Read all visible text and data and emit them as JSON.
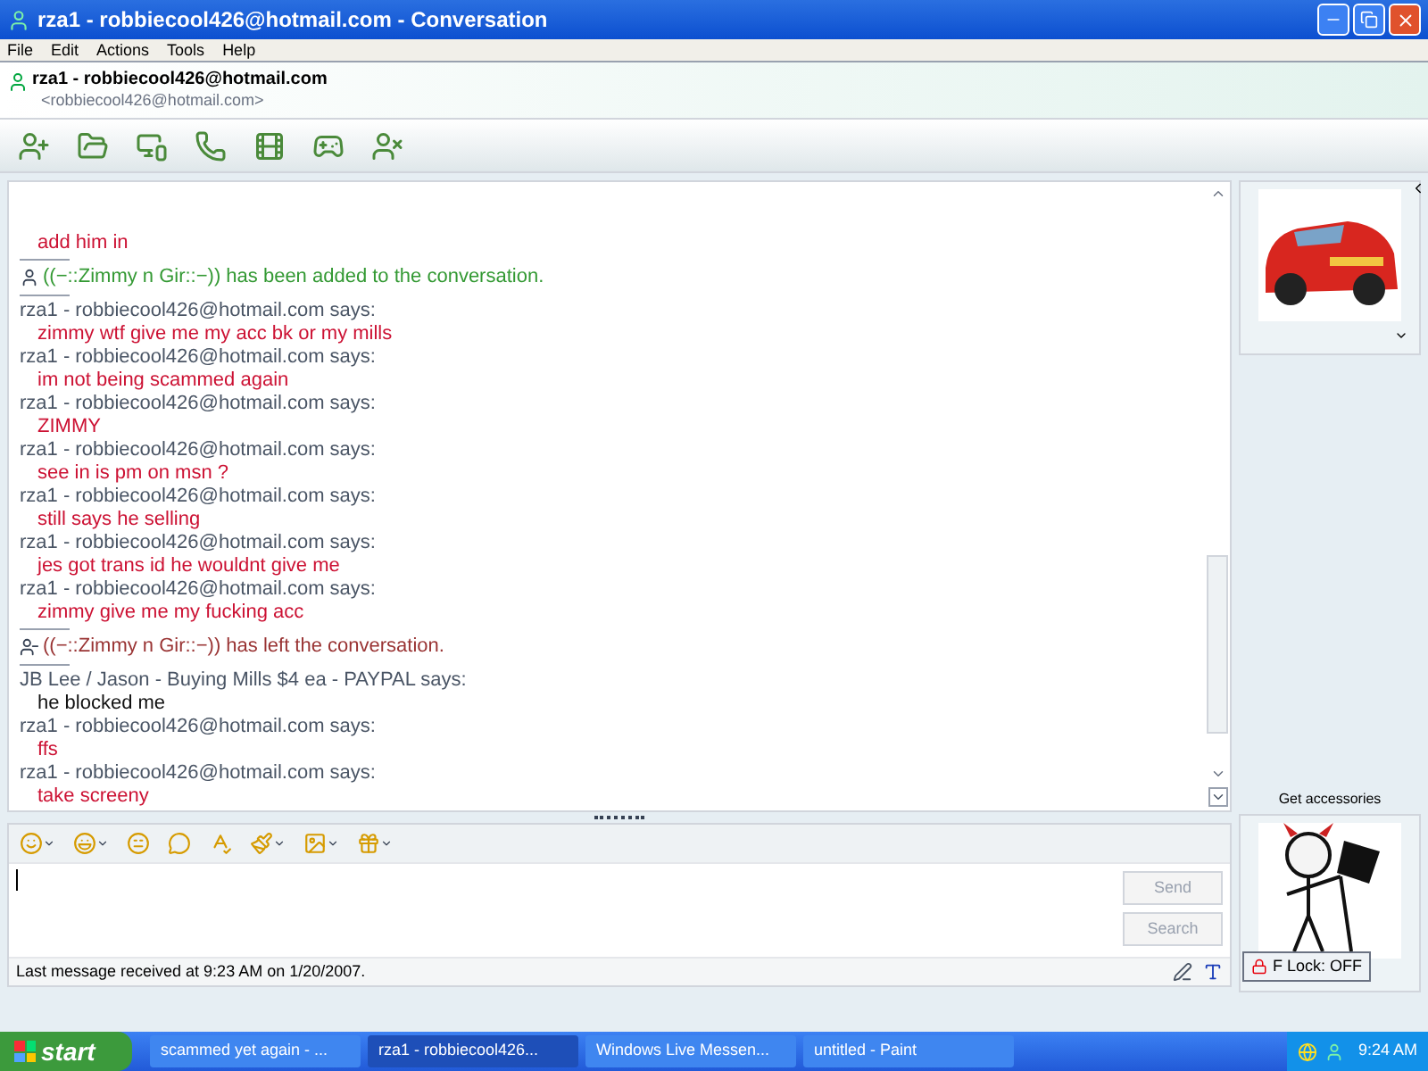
{
  "window": {
    "title": "rza1 - robbiecool426@hotmail.com - Conversation"
  },
  "menu": [
    "File",
    "Edit",
    "Actions",
    "Tools",
    "Help"
  ],
  "contact": {
    "name": "rza1 - robbiecool426@hotmail.com",
    "email": "<robbiecool426@hotmail.com>"
  },
  "messages": [
    {
      "kind": "message",
      "text": "add him in",
      "color": "#cc1133"
    },
    {
      "kind": "joined",
      "text": "((−::Zimmy n Gir::−)) has been added to the conversation.",
      "color": "#339933"
    },
    {
      "kind": "message",
      "sender": "rza1 - robbiecool426@hotmail.com says:",
      "text": "zimmy wtf give me my acc bk or my mills",
      "color": "#cc1133"
    },
    {
      "kind": "message",
      "sender": "rza1 - robbiecool426@hotmail.com says:",
      "text": "im not being scammed again",
      "color": "#cc1133"
    },
    {
      "kind": "message",
      "sender": "rza1 - robbiecool426@hotmail.com says:",
      "text": "ZIMMY",
      "color": "#cc1133"
    },
    {
      "kind": "message",
      "sender": "rza1 - robbiecool426@hotmail.com says:",
      "text": "see in is pm on msn ?",
      "color": "#cc1133"
    },
    {
      "kind": "message",
      "sender": "rza1 - robbiecool426@hotmail.com says:",
      "text": "still says he selling",
      "color": "#cc1133"
    },
    {
      "kind": "message",
      "sender": "rza1 - robbiecool426@hotmail.com says:",
      "text": "jes got trans id he wouldnt give me",
      "color": "#cc1133"
    },
    {
      "kind": "message",
      "sender": "rza1 - robbiecool426@hotmail.com says:",
      "text": "zimmy give me my fucking acc",
      "color": "#cc1133"
    },
    {
      "kind": "left",
      "text": "((−::Zimmy n Gir::−)) has left the conversation.",
      "color": "#993333"
    },
    {
      "kind": "message",
      "sender": "JB Lee / Jason - Buying Mills $4 ea - PAYPAL says:",
      "text": "he blocked me",
      "color": "#111111"
    },
    {
      "kind": "message",
      "sender": "rza1 - robbiecool426@hotmail.com says:",
      "text": "ffs",
      "color": "#cc1133"
    },
    {
      "kind": "message",
      "sender": "rza1 - robbiecool426@hotmail.com says:",
      "text": "take screeny",
      "color": "#cc1133"
    }
  ],
  "input": {
    "send": {
      "label": "Send",
      "disabled": true
    },
    "search": {
      "label": "Search",
      "disabled": true
    }
  },
  "status": "Last message received at 9:23 AM on 1/20/2007.",
  "sidebar": {
    "accessories": "Get accessories",
    "tooltip": "F Lock: OFF"
  },
  "taskbar": {
    "start": "start",
    "items": [
      {
        "label": "scammed yet again - ...",
        "selected": false
      },
      {
        "label": "rza1 - robbiecool426...",
        "selected": true
      },
      {
        "label": "Windows Live Messen...",
        "selected": false
      },
      {
        "label": "untitled - Paint",
        "selected": false
      }
    ],
    "clock": "9:24 AM"
  }
}
